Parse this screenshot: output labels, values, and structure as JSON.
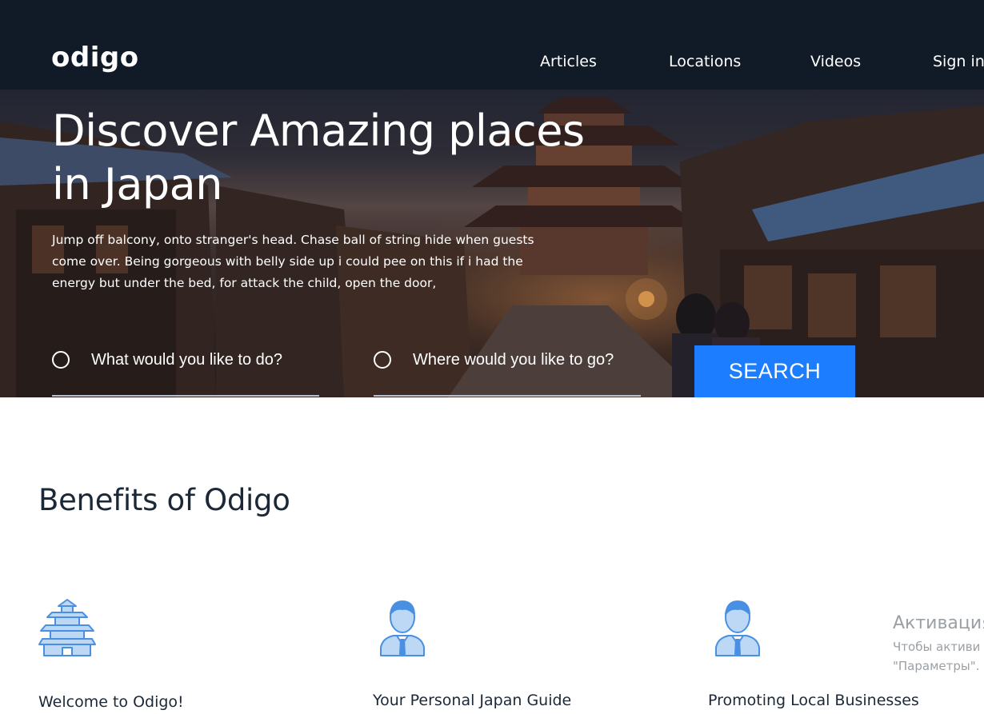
{
  "header": {
    "logo": "odigo",
    "nav": [
      {
        "label": "Articles"
      },
      {
        "label": "Locations"
      },
      {
        "label": "Videos"
      },
      {
        "label": "Sign in"
      }
    ]
  },
  "hero": {
    "title": "Discover Amazing places in Japan",
    "text": "Jump off balcony, onto stranger's head. Chase ball of string hide when guests come over. Being gorgeous with belly side up i could pee on this if i had the energy but under the bed, for attack the child, open the door,",
    "search": {
      "what_placeholder": "What would you like to do?",
      "where_placeholder": "Where would you like to go?",
      "button_label": "SEARCH"
    }
  },
  "benefits": {
    "title": "Benefits of Odigo",
    "items": [
      {
        "label": "Welcome to Odigo!",
        "icon": "pagoda-castle-icon"
      },
      {
        "label": "Your Personal Japan Guide",
        "icon": "person-guide-icon"
      },
      {
        "label": "Promoting Local Businesses",
        "icon": "person-business-icon"
      }
    ]
  },
  "watermark": {
    "line1": "Активация",
    "line2": "Чтобы активи",
    "line3": "\"Параметры\"."
  },
  "colors": {
    "header_bg": "#101b27",
    "accent": "#1c7eff",
    "icon_blue": "#4a90e2",
    "text_dark": "#1b2838"
  }
}
